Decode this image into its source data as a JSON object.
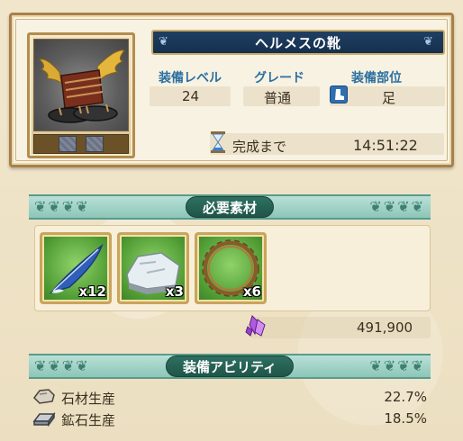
{
  "item": {
    "name": "ヘルメスの靴",
    "image_icon": "winged-sandals-icon"
  },
  "stats": {
    "level_label": "装備レベル",
    "level_value": "24",
    "grade_label": "グレード",
    "grade_value": "普通",
    "part_label": "装備部位",
    "part_value": "足",
    "part_icon": "boot-icon"
  },
  "timer": {
    "label": "完成まで",
    "value": "14:51:22",
    "icon": "hourglass-icon"
  },
  "materials": {
    "header": "必要素材",
    "items": [
      {
        "icon": "blue-feather-icon",
        "qty": "x12"
      },
      {
        "icon": "white-stone-icon",
        "qty": "x3"
      },
      {
        "icon": "vine-ring-icon",
        "qty": "x6"
      }
    ],
    "cost_icon": "purple-crystal-icon",
    "cost_value": "491,900"
  },
  "abilities": {
    "header": "装備アビリティ",
    "items": [
      {
        "icon": "stone-icon",
        "name": "石材生産",
        "value": "22.7%"
      },
      {
        "icon": "ore-ingot-icon",
        "name": "鉱石生産",
        "value": "18.5%"
      }
    ]
  },
  "colors": {
    "title_bar": "#1f3f62",
    "label_blue": "#2b6fa0",
    "section_teal": "#2e7061",
    "frame_gold": "#c9a45c"
  }
}
